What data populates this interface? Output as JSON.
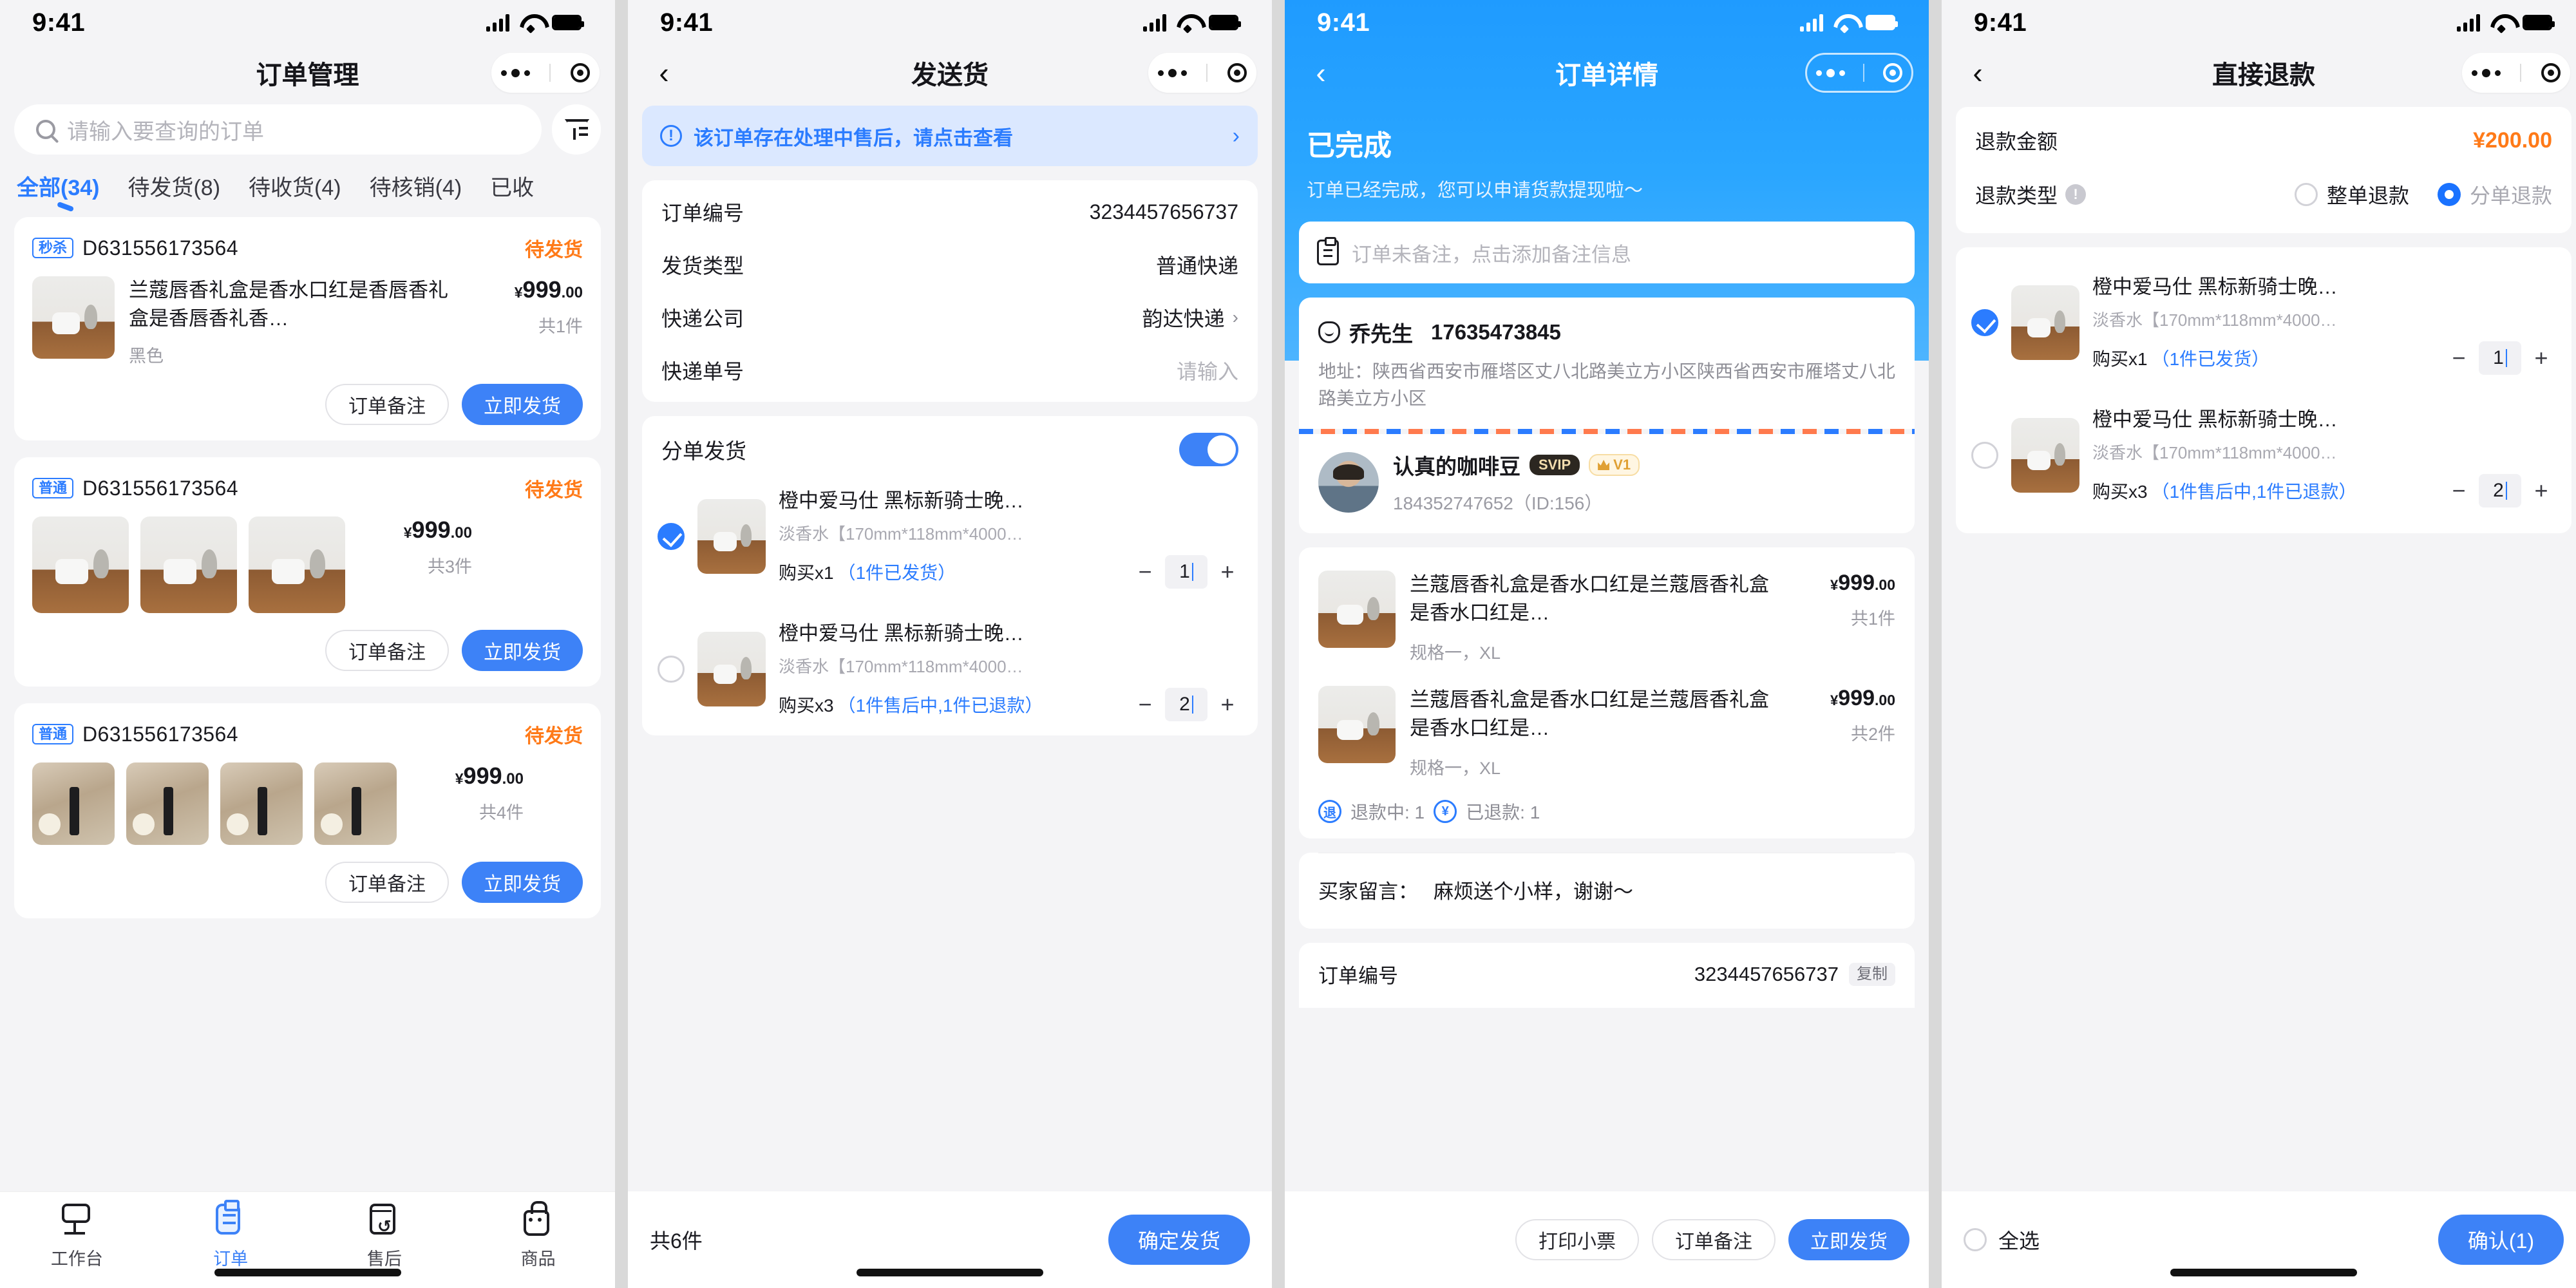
{
  "status_bar": {
    "time": "9:41",
    "signal_icon": "signal-bars-icon",
    "wifi_icon": "wifi-icon",
    "battery_icon": "battery-icon"
  },
  "panel1": {
    "nav": {
      "title": "订单管理",
      "more_icon": "more-dots-icon",
      "target_icon": "capsule-target-icon"
    },
    "search": {
      "placeholder": "请输入要查询的订单",
      "value": "",
      "icon": "search-icon",
      "filter_icon": "filter-funnel-icon"
    },
    "tabs": [
      {
        "label": "全部(34)",
        "active": true
      },
      {
        "label": "待发货(8)",
        "active": false
      },
      {
        "label": "待收货(4)",
        "active": false
      },
      {
        "label": "待核销(4)",
        "active": false
      },
      {
        "label": "已收",
        "active": false
      }
    ],
    "orders": [
      {
        "tag": "秒杀",
        "order_no": "D631556173564",
        "status": "待发货",
        "layout": "single",
        "thumb_style": "t-lamp",
        "title": "兰蔻唇香礼盒是香水口红是香唇香礼盒是香唇香礼香…",
        "spec": "黑色",
        "currency": "¥",
        "price_int": "999",
        "price_dec": ".00",
        "qty": "共1件",
        "btn_note": "订单备注",
        "btn_ship": "立即发货"
      },
      {
        "tag": "普通",
        "order_no": "D631556173564",
        "status": "待发货",
        "layout": "gallery3",
        "thumb_style": "t-lamp",
        "currency": "¥",
        "price_int": "999",
        "price_dec": ".00",
        "qty": "共3件",
        "btn_note": "订单备注",
        "btn_ship": "立即发货"
      },
      {
        "tag": "普通",
        "order_no": "D631556173564",
        "status": "待发货",
        "layout": "gallery4",
        "thumb_style": "t-jo",
        "currency": "¥",
        "price_int": "999",
        "price_dec": ".00",
        "qty": "共4件",
        "btn_note": "订单备注",
        "btn_ship": "立即发货"
      }
    ],
    "tabbar": [
      {
        "label": "工作台",
        "icon": "workbench-icon",
        "active": false
      },
      {
        "label": "订单",
        "icon": "order-icon",
        "active": true
      },
      {
        "label": "售后",
        "icon": "aftersale-icon",
        "active": false
      },
      {
        "label": "商品",
        "icon": "goods-icon",
        "active": false
      }
    ]
  },
  "panel2": {
    "nav": {
      "back_icon": "back-chevron-icon",
      "title": "发送货",
      "more_icon": "more-dots-icon",
      "target_icon": "capsule-target-icon"
    },
    "alert": {
      "icon": "exclamation-circle-icon",
      "text": "该订单存在处理中售后，请点击查看",
      "chevron": "chevron-right-icon"
    },
    "rows": [
      {
        "label": "订单编号",
        "value": "3234457656737",
        "chevron": false,
        "placeholder": false
      },
      {
        "label": "发货类型",
        "value": "普通快递",
        "chevron": false,
        "placeholder": false
      },
      {
        "label": "快递公司",
        "value": "韵达快递",
        "chevron": true,
        "placeholder": false
      },
      {
        "label": "快递单号",
        "value": "请输入",
        "chevron": false,
        "placeholder": true
      }
    ],
    "split": {
      "label": "分单发货",
      "switch_on": true
    },
    "items": [
      {
        "checked": true,
        "title": "橙中爱马仕 黑标新骑士晚…",
        "sub": "淡香水【170mm*118mm*4000…",
        "buy": "购买x1",
        "note": "（1件已发货）",
        "qty": "1"
      },
      {
        "checked": false,
        "title": "橙中爱马仕 黑标新骑士晚…",
        "sub": "淡香水【170mm*118mm*4000…",
        "buy": "购买x3",
        "note": "（1件售后中,1件已退款）",
        "qty": "2"
      }
    ],
    "footer": {
      "total": "共6件",
      "confirm": "确定发货"
    }
  },
  "panel3": {
    "nav": {
      "back_icon": "back-chevron-icon",
      "title": "订单详情",
      "more_icon": "more-dots-icon",
      "target_icon": "capsule-target-icon"
    },
    "hero": {
      "status": "已完成",
      "desc": "订单已经完成，您可以申请货款提现啦～",
      "accent": "#1f9bff"
    },
    "remark": {
      "icon": "note-icon",
      "placeholder": "订单未备注，点击添加备注信息"
    },
    "address": {
      "icon": "location-icon",
      "name": "乔先生",
      "phone": "17635473845",
      "text": "地址：陕西省西安市雁塔区丈八北路美立方小区陕西省西安市雁塔丈八北路美立方小区"
    },
    "buyer": {
      "avatar": "avatar",
      "name": "认真的咖啡豆",
      "svip": "SVIP",
      "level": "V1",
      "crown_icon": "crown-icon",
      "id_line": "184352747652（ID:156）"
    },
    "goods": [
      {
        "title": "兰蔻唇香礼盒是香水口红是兰蔻唇香礼盒是香水口红是…",
        "spec": "规格一，XL",
        "currency": "¥",
        "price_int": "999",
        "price_dec": ".00",
        "qty": "共1件"
      },
      {
        "title": "兰蔻唇香礼盒是香水口红是兰蔻唇香礼盒是香水口红是…",
        "spec": "规格一，XL",
        "currency": "¥",
        "price_int": "999",
        "price_dec": ".00",
        "qty": "共2件"
      }
    ],
    "refund_tags": [
      {
        "icon": "refunding-icon",
        "glyph": "退",
        "text": "退款中: 1"
      },
      {
        "icon": "refunded-icon",
        "glyph": "¥",
        "text": "已退款: 1"
      }
    ],
    "message": {
      "label": "买家留言：",
      "value": "麻烦送个小样，谢谢～"
    },
    "order_no": {
      "label": "订单编号",
      "value": "3234457656737",
      "copy": "复制"
    },
    "footer": {
      "print": "打印小票",
      "note": "订单备注",
      "ship": "立即发货"
    }
  },
  "panel4": {
    "nav": {
      "back_icon": "back-chevron-icon",
      "title": "直接退款",
      "more_icon": "more-dots-icon",
      "target_icon": "capsule-target-icon"
    },
    "amount": {
      "label": "退款金额",
      "value": "¥200.00",
      "color": "#ff7a18"
    },
    "type": {
      "label": "退款类型",
      "info_icon": "info-circle-icon",
      "options": [
        {
          "label": "整单退款",
          "selected": false
        },
        {
          "label": "分单退款",
          "selected": true
        }
      ]
    },
    "items": [
      {
        "checked": true,
        "title": "橙中爱马仕 黑标新骑士晚…",
        "sub": "淡香水【170mm*118mm*4000…",
        "buy": "购买x1",
        "note": "（1件已发货）",
        "qty": "1"
      },
      {
        "checked": false,
        "title": "橙中爱马仕 黑标新骑士晚…",
        "sub": "淡香水【170mm*118mm*4000…",
        "buy": "购买x3",
        "note": "（1件售后中,1件已退款）",
        "qty": "2"
      }
    ],
    "footer": {
      "select_all": "全选",
      "confirm": "确认(1)"
    }
  }
}
